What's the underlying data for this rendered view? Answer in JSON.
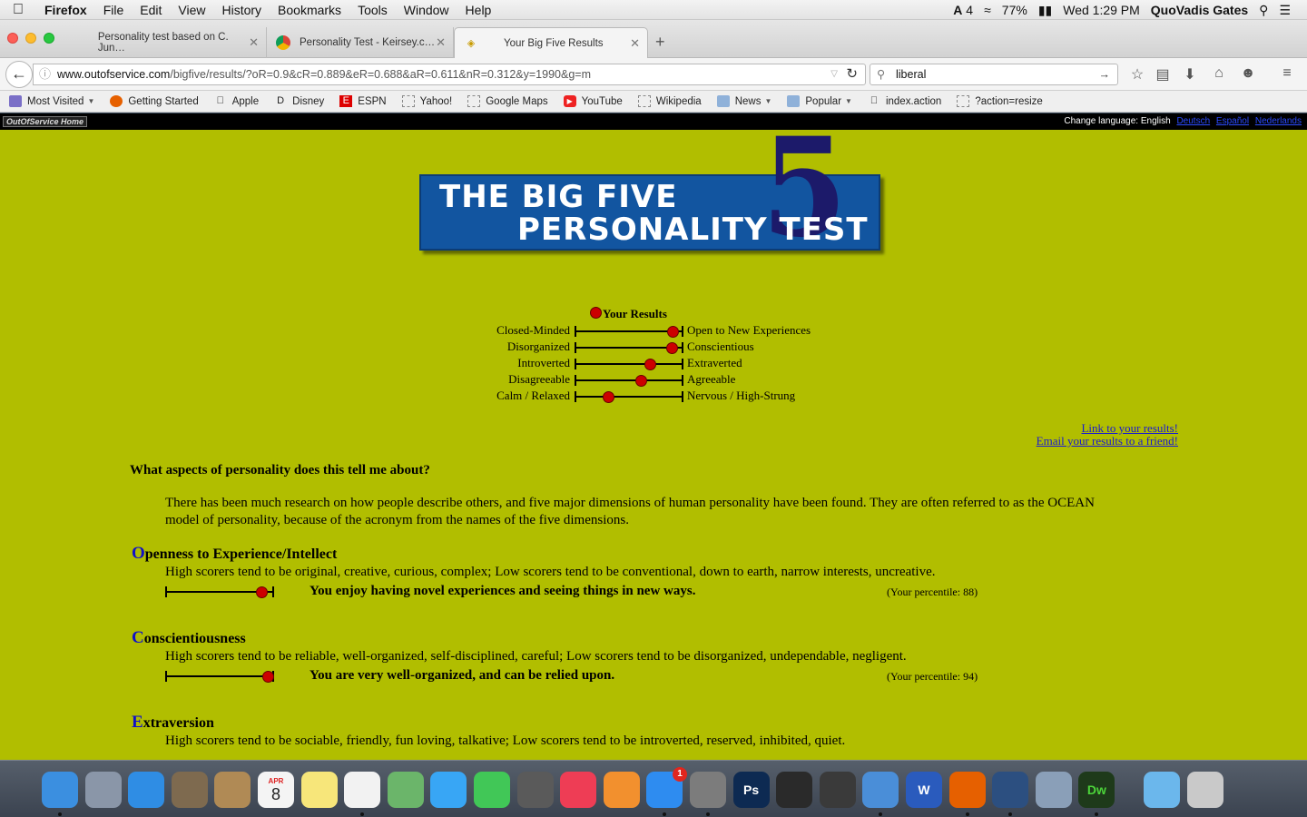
{
  "menubar": {
    "apple": "",
    "items": [
      "Firefox",
      "File",
      "Edit",
      "View",
      "History",
      "Bookmarks",
      "Tools",
      "Window",
      "Help"
    ],
    "battery": "77%",
    "adobe_count": "4",
    "clock": "Wed 1:29 PM",
    "user": "QuoVadis Gates"
  },
  "tabs": [
    {
      "title": "Personality test based on C. Jun…"
    },
    {
      "title": "Personality Test - Keirsey.c…"
    },
    {
      "title": "Your Big Five Results"
    }
  ],
  "navbar": {
    "url_domain": "www.outofservice.com",
    "url_path": "/bigfive/results/?oR=0.9&cR=0.889&eR=0.688&aR=0.611&nR=0.312&y=1990&g=m",
    "search_value": "liberal"
  },
  "bookmarks": [
    "Most Visited",
    "Getting Started",
    "Apple",
    "Disney",
    "ESPN",
    "Yahoo!",
    "Google Maps",
    "YouTube",
    "Wikipedia",
    "News",
    "Popular",
    "index.action",
    "?action=resize"
  ],
  "site": {
    "home_label": "OutOfService Home",
    "lang_label": "Change language: English",
    "lang_links": [
      "Deutsch",
      "Español",
      "Nederlands"
    ]
  },
  "logo": {
    "line1": "THE BIG FIVE",
    "line2": "PERSONALITY TEST",
    "numeral": "5"
  },
  "results": {
    "title": "Your Results",
    "traits": [
      {
        "low": "Closed-Minded",
        "high": "Open to New Experiences",
        "score": 0.9
      },
      {
        "low": "Disorganized",
        "high": "Conscientious",
        "score": 0.889
      },
      {
        "low": "Introverted",
        "high": "Extraverted",
        "score": 0.688
      },
      {
        "low": "Disagreeable",
        "high": "Agreeable",
        "score": 0.611
      },
      {
        "low": "Calm / Relaxed",
        "high": "Nervous / High-Strung",
        "score": 0.312
      }
    ]
  },
  "links": {
    "link": "Link to your results!",
    "email": "Email your results to a friend!"
  },
  "question": "What aspects of personality does this tell me about?",
  "intro": "There has been much research on how people describe others, and five major dimensions of human personality have been found. They are often referred to as the OCEAN model of personality, because of the acronym from the names of the five dimensions.",
  "dimensions": [
    {
      "initial": "O",
      "rest": "penness to Experience/Intellect",
      "desc": "High scorers tend to be original, creative, curious, complex; Low scorers tend to be conventional, down to earth, narrow interests, uncreative.",
      "verdict": "You enjoy having novel experiences and seeing things in new ways.",
      "pct": "(Your percentile: 88)",
      "score": 0.88
    },
    {
      "initial": "C",
      "rest": "onscientiousness",
      "desc": "High scorers tend to be reliable, well-organized, self-disciplined, careful; Low scorers tend to be disorganized, undependable, negligent.",
      "verdict": "You are very well-organized, and can be relied upon.",
      "pct": "(Your percentile: 94)",
      "score": 0.94
    },
    {
      "initial": "E",
      "rest": "xtraversion",
      "desc": "High scorers tend to be sociable, friendly, fun loving, talkative; Low scorers tend to be introverted, reserved, inhibited, quiet.",
      "verdict": "",
      "pct": "",
      "score": null
    }
  ],
  "dock": {
    "badge": "1",
    "apps": [
      "Finder",
      "Launchpad",
      "Safari",
      "Mail",
      "Contacts",
      "Calendar",
      "Notes",
      "Reminders",
      "Maps",
      "Messages",
      "FaceTime",
      "Photo Booth",
      "iTunes",
      "iBooks",
      "App Store",
      "System Preferences",
      "Photoshop",
      "Final Cut Pro",
      "Acrobat",
      "Xcode",
      "Word",
      "Firefox",
      "QuickTime",
      "Preview",
      "Dreamweaver",
      "Downloads",
      "Trash"
    ],
    "icon_labels": {
      "calendar_month": "APR",
      "calendar_day": "8",
      "photoshop": "Ps",
      "word": "W",
      "dreamweaver": "Dw"
    }
  }
}
